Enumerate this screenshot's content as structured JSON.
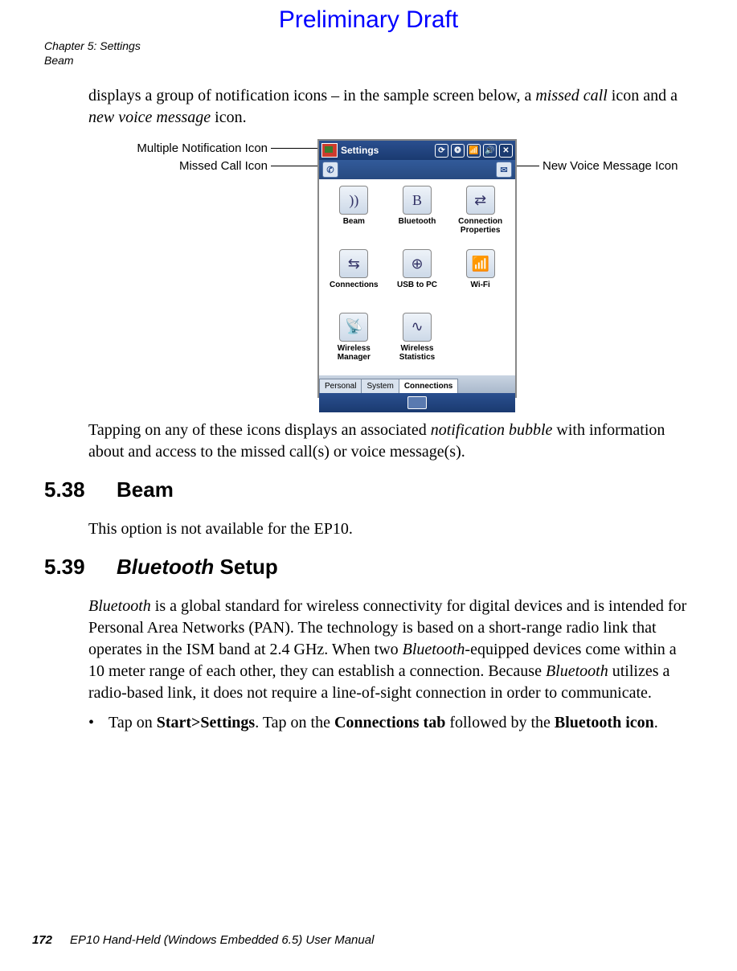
{
  "watermark": "Preliminary Draft",
  "header": {
    "line1": "Chapter 5: Settings",
    "line2": "Beam"
  },
  "intro": {
    "pre": "displays a group of notification icons – in the sample screen below, a ",
    "em1": "missed call",
    "mid": " icon and a ",
    "em2": "new voice message",
    "post": " icon."
  },
  "callouts": {
    "multi": "Multiple Notification Icon",
    "missed": "Missed Call Icon",
    "voice": "New Voice Message Icon"
  },
  "phone": {
    "title": "Settings",
    "tabs": [
      "Personal",
      "System",
      "Connections"
    ],
    "activeTab": 2,
    "items": [
      {
        "label": "Beam",
        "glyph": "))"
      },
      {
        "label": "Bluetooth",
        "glyph": "B"
      },
      {
        "label": "Connection Properties",
        "glyph": "⇄"
      },
      {
        "label": "Connections",
        "glyph": "⇆"
      },
      {
        "label": "USB to PC",
        "glyph": "⊕"
      },
      {
        "label": "Wi-Fi",
        "glyph": "📶"
      },
      {
        "label": "Wireless Manager",
        "glyph": "📡"
      },
      {
        "label": "Wireless Statistics",
        "glyph": "∿"
      }
    ]
  },
  "after_figure": {
    "pre": "Tapping on any of these icons displays an associated ",
    "em": "notification bubble",
    "post": " with information about and access to the missed call(s) or voice message(s)."
  },
  "sections": {
    "beam": {
      "num": "5.38",
      "title": "Beam",
      "body": "This option is not available for the EP10."
    },
    "bt": {
      "num": "5.39",
      "title_em": "Bluetooth",
      "title_rest": " Setup",
      "p1_em1": "Bluetooth",
      "p1_a": " is a global standard for wireless connectivity for digital devices and is intended for Personal Area Networks (PAN). The technology is based on a short-range radio link that operates in the ISM band at 2.4 GHz. When two ",
      "p1_em2": "Bluetooth",
      "p1_b": "-equipped devices come within a 10 meter range of each other, they can establish a connection. Because ",
      "p1_em3": "Bluetooth",
      "p1_c": " utilizes a radio-based link, it does not require a line-of-sight connection in order to communicate.",
      "bullet_pre": "Tap on ",
      "bullet_b1": "Start>Settings",
      "bullet_mid": ". Tap on the ",
      "bullet_b2": "Connections tab",
      "bullet_mid2": " followed by the ",
      "bullet_b3": "Bluetooth icon",
      "bullet_post": "."
    }
  },
  "footer": {
    "page": "172",
    "text": "EP10 Hand-Held (Windows Embedded 6.5) User Manual"
  }
}
